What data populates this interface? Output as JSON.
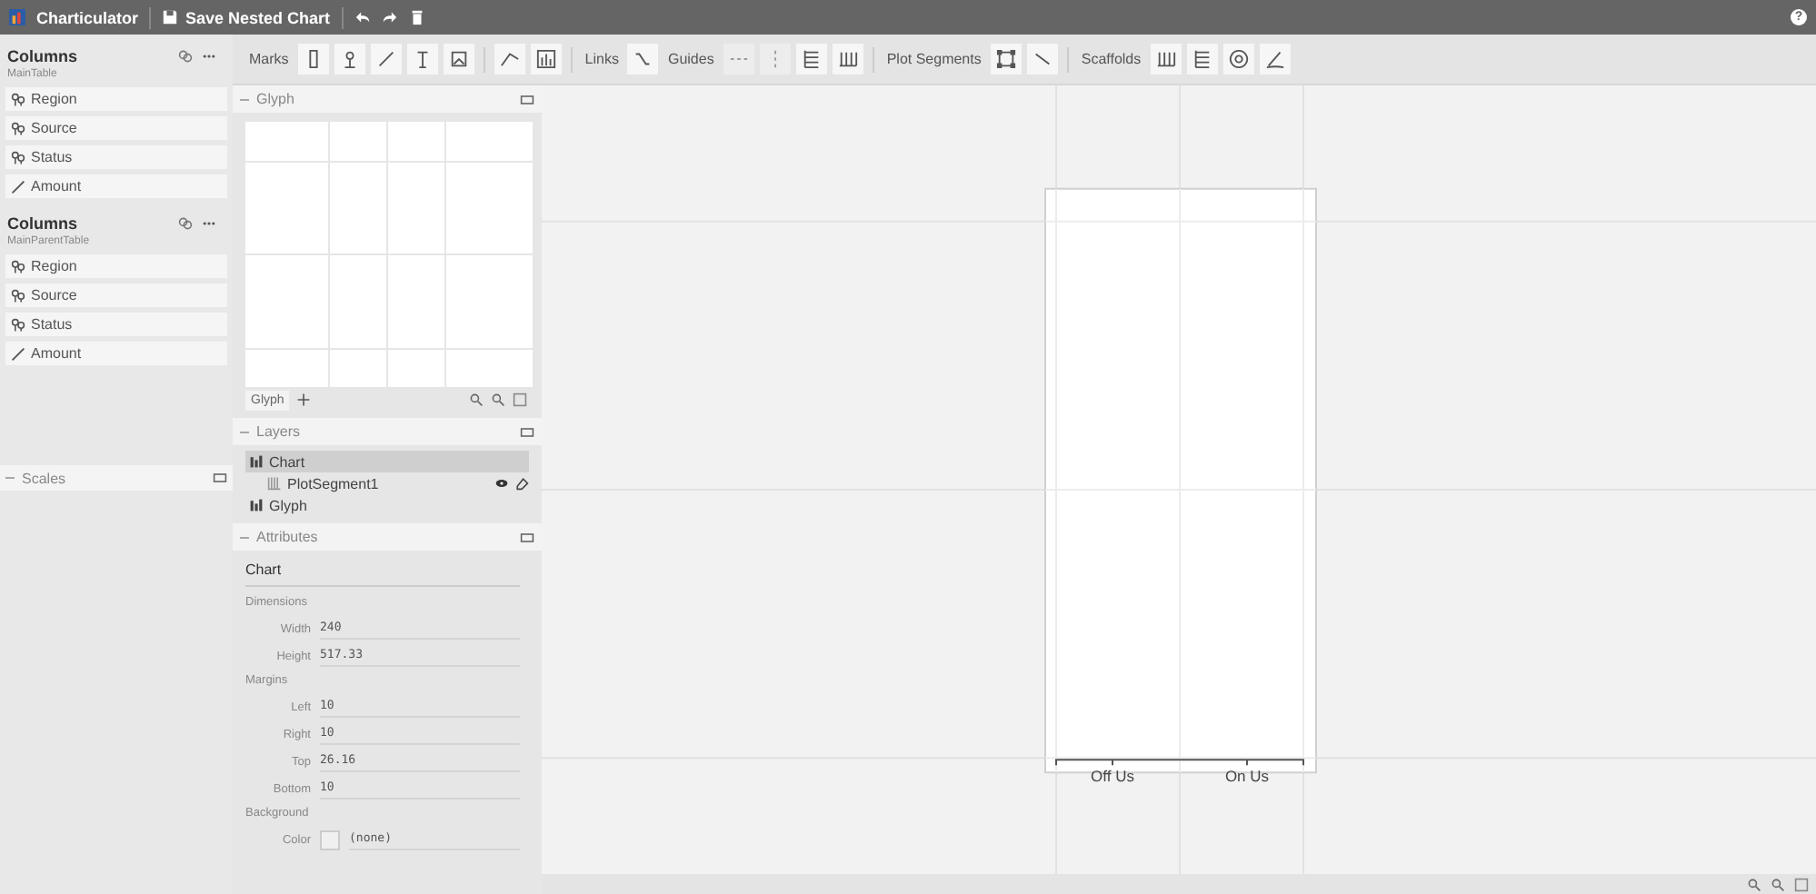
{
  "app": {
    "title": "Charticulator",
    "save_label": "Save Nested Chart"
  },
  "help": "?",
  "toolbar": [
    {
      "label": "Marks",
      "tools": [
        {
          "kind": "rect",
          "disabled": false
        },
        {
          "kind": "symbol",
          "disabled": false
        },
        {
          "kind": "line",
          "disabled": false
        },
        {
          "kind": "text",
          "disabled": false
        },
        {
          "kind": "image",
          "disabled": false
        },
        {
          "kind": "axis",
          "disabled": false
        },
        {
          "kind": "nested",
          "disabled": false
        }
      ]
    },
    {
      "label": "Links",
      "tools": [
        {
          "kind": "link",
          "disabled": false
        }
      ]
    },
    {
      "label": "Guides",
      "tools": [
        {
          "kind": "hguide",
          "disabled": true
        },
        {
          "kind": "vguide",
          "disabled": true
        },
        {
          "kind": "hgrid",
          "disabled": false
        },
        {
          "kind": "vgrid",
          "disabled": false
        }
      ]
    },
    {
      "label": "Plot Segments",
      "tools": [
        {
          "kind": "region",
          "disabled": false
        },
        {
          "kind": "segment",
          "disabled": false
        }
      ]
    },
    {
      "label": "Scaffolds",
      "tools": [
        {
          "kind": "xscaffold",
          "disabled": false
        },
        {
          "kind": "yscaffold",
          "disabled": false
        },
        {
          "kind": "polar",
          "disabled": false
        },
        {
          "kind": "curve",
          "disabled": false
        }
      ]
    }
  ],
  "datasets": [
    {
      "title": "Columns",
      "table": "MainTable",
      "columns": [
        {
          "name": "Region",
          "kind": "categorical"
        },
        {
          "name": "Source",
          "kind": "categorical"
        },
        {
          "name": "Status",
          "kind": "categorical"
        },
        {
          "name": "Amount",
          "kind": "numerical"
        }
      ]
    },
    {
      "title": "Columns",
      "table": "MainParentTable",
      "columns": [
        {
          "name": "Region",
          "kind": "categorical"
        },
        {
          "name": "Source",
          "kind": "categorical"
        },
        {
          "name": "Status",
          "kind": "categorical"
        },
        {
          "name": "Amount",
          "kind": "numerical"
        }
      ]
    }
  ],
  "scales": {
    "title": "Scales"
  },
  "glyph": {
    "title": "Glyph",
    "tab": "Glyph"
  },
  "layers": {
    "title": "Layers",
    "items": [
      {
        "name": "Chart",
        "selected": true,
        "children": [
          {
            "name": "PlotSegment1",
            "selected": false
          }
        ]
      },
      {
        "name": "Glyph",
        "selected": false
      }
    ]
  },
  "attributes": {
    "title": "Attributes",
    "object": "Chart",
    "sections": [
      {
        "title": "Dimensions",
        "fields": [
          {
            "label": "Width",
            "value": "240"
          },
          {
            "label": "Height",
            "value": "517.33"
          }
        ]
      },
      {
        "title": "Margins",
        "fields": [
          {
            "label": "Left",
            "value": "10"
          },
          {
            "label": "Right",
            "value": "10"
          },
          {
            "label": "Top",
            "value": "26.16"
          },
          {
            "label": "Bottom",
            "value": "10"
          }
        ]
      },
      {
        "title": "Background",
        "fields": [
          {
            "label": "Color",
            "value": "(none)",
            "kind": "color"
          }
        ]
      }
    ]
  },
  "canvas": {
    "axis_labels": [
      "Off Us",
      "On Us"
    ]
  }
}
